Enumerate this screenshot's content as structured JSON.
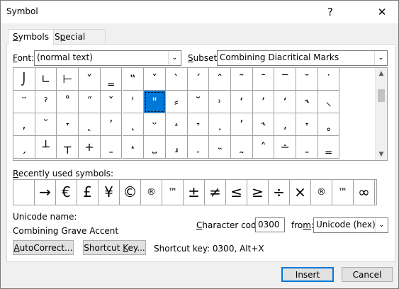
{
  "window": {
    "title": "Symbol",
    "help_icon": "?",
    "close_icon": "✕"
  },
  "tabs": [
    {
      "label": "Symbols",
      "access": "S"
    },
    {
      "label": "Special Characters",
      "access": "P"
    }
  ],
  "font": {
    "label": "Font:",
    "value": "(normal text)"
  },
  "subset": {
    "label": "Subset:",
    "value": "Combining Diacritical Marks"
  },
  "symbol_grid": {
    "rows": [
      [
        "⌡",
        "∟",
        "⊦",
        "˅",
        "‗",
        "〃",
        "̌",
        "̀",
        "́",
        "̂",
        "̃",
        "̄",
        "̅",
        "̆",
        "̇"
      ],
      [
        "̈",
        "̉",
        "̊",
        "̋",
        "̌",
        "̍",
        "̎",
        "̏",
        "̐",
        "̑",
        "̒",
        "̓",
        "̔",
        "̕",
        "̖"
      ],
      [
        "̗",
        "̘",
        "̙",
        "̚",
        "̛",
        "̜",
        "̝",
        "̞",
        "̟",
        "̠",
        "̡",
        "̢",
        "̣",
        "̤",
        "̥"
      ],
      [
        "̦",
        "̧",
        "̨",
        "̩",
        "̪",
        "̫",
        "̬",
        "̭",
        "̮",
        "̯",
        "̰",
        "̱",
        "̲",
        "̳",
        "̴"
      ]
    ],
    "display_rows": [
      [
        "⌡",
        "∟",
        "⊢",
        "˅",
        "‗",
        "‟",
        "ˇ",
        "ˋ",
        "ˊ",
        "ˆ",
        "˜",
        "ˉ",
        "‾",
        "˘",
        "˙"
      ],
      [
        "¨",
        "ˀ",
        "˚",
        "˝",
        "ˇ",
        "ˈ",
        "\"",
        "⸗",
        "˘",
        "˒",
        "‘",
        "’",
        "‘",
        "˞",
        "⸜"
      ],
      [
        "‚",
        "˘",
        "˕",
        "˻",
        "ʼ",
        "˛",
        "ᵕ",
        "˔",
        "˕",
        "˰",
        "ʼ",
        "˞",
        "‚",
        "˕",
        "˳"
      ],
      [
        "ˏ",
        "┴",
        "┬",
        "+",
        "ˍ",
        "˔",
        "˽",
        "⸥",
        "˰",
        "˵",
        "˷",
        "˄",
        "∸",
        "ˍ",
        "‗"
      ]
    ],
    "selected_row": 1,
    "selected_col": 6
  },
  "recent": {
    "label": "Recently used symbols:",
    "symbols": [
      "",
      "→",
      "€",
      "£",
      "¥",
      "©",
      "®",
      "™",
      "±",
      "≠",
      "≤",
      "≥",
      "÷",
      "×",
      "®",
      "™",
      "∞"
    ]
  },
  "unicode_name": {
    "label": "Unicode name:",
    "value": "Combining Grave Accent"
  },
  "char_code": {
    "label": "Character code:",
    "value": "0300",
    "from_label": "from:",
    "from_value": "Unicode (hex)"
  },
  "buttons": {
    "autocorrect": "AutoCorrect...",
    "shortcut_key": "Shortcut Key..."
  },
  "shortcut_text": "Shortcut key: 0300, Alt+X",
  "footer": {
    "insert": "Insert",
    "cancel": "Cancel"
  }
}
